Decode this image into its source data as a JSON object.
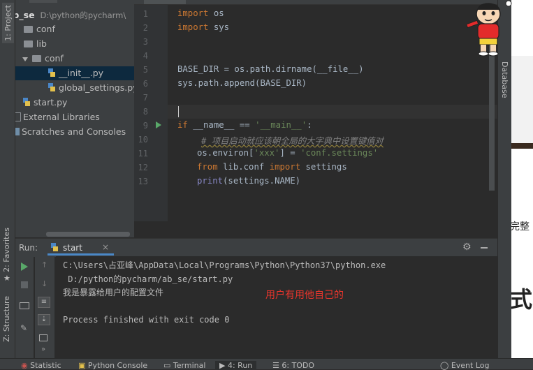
{
  "left_strip": {
    "project_tab": "1: Project",
    "favorites_tab": "2: Favorites",
    "structure_tab": "Z: Structure"
  },
  "project": {
    "root_name": "ab_se",
    "root_path": "D:\\python的pycharm\\",
    "items": [
      {
        "label": "conf",
        "type": "folder"
      },
      {
        "label": "lib",
        "type": "folder"
      },
      {
        "label": "conf",
        "type": "folder"
      },
      {
        "label": "__init__.py",
        "type": "py"
      },
      {
        "label": "global_settings.py",
        "type": "py"
      },
      {
        "label": "start.py",
        "type": "py"
      },
      {
        "label": "External Libraries",
        "type": "lib"
      },
      {
        "label": "Scratches and Consoles",
        "type": "scratch"
      }
    ]
  },
  "editor": {
    "line_numbers": [
      "1",
      "2",
      "3",
      "4",
      "5",
      "6",
      "7",
      "8",
      "9",
      "10",
      "11",
      "12",
      "13"
    ],
    "lines": {
      "l1_kw": "import",
      "l1_rest": " os",
      "l2_kw": "import",
      "l2_rest": " sys",
      "l5": "BASE_DIR = os.path.dirname(__file__)",
      "l6": "sys.path.append(BASE_DIR)",
      "l9_kw": "if",
      "l9_a": " __name__ == ",
      "l9_str": "'__main__'",
      "l9_b": ":",
      "l10_cmt": "# 项目启动就应该朝全局的大字典中设置键值对",
      "l11_a": "os.environ[",
      "l11_s1": "'xxx'",
      "l11_b": "] = ",
      "l11_s2": "'conf.settings'",
      "l12_kw1": "from",
      "l12_a": " lib.conf ",
      "l12_kw2": "import",
      "l12_b": " settings",
      "l13_kw": "print",
      "l13_a": "(settings.NAME)"
    }
  },
  "right_strip": {
    "database_tab": "Database"
  },
  "white_area": {
    "text_a": "完整",
    "text_b": "式"
  },
  "run_panel": {
    "run_label": "Run:",
    "tab_label": "start",
    "console_lines": [
      "C:\\Users\\占亚峰\\AppData\\Local\\Programs\\Python\\Python37\\python.exe",
      " D:/python的pycharm/ab_se/start.py",
      "我是暴露给用户的配置文件",
      "",
      "Process finished with exit code 0"
    ],
    "annotation": "用户有用他自己的"
  },
  "bottom_bar": {
    "statistic": "Statistic",
    "python_console": "Python Console",
    "terminal": "Terminal",
    "run": "4: Run",
    "todo": "6: TODO",
    "event_log": "Event Log"
  },
  "colors": {
    "annotation": "#e8352c",
    "run_green": "#59a869",
    "background": "#2b2b2b"
  }
}
